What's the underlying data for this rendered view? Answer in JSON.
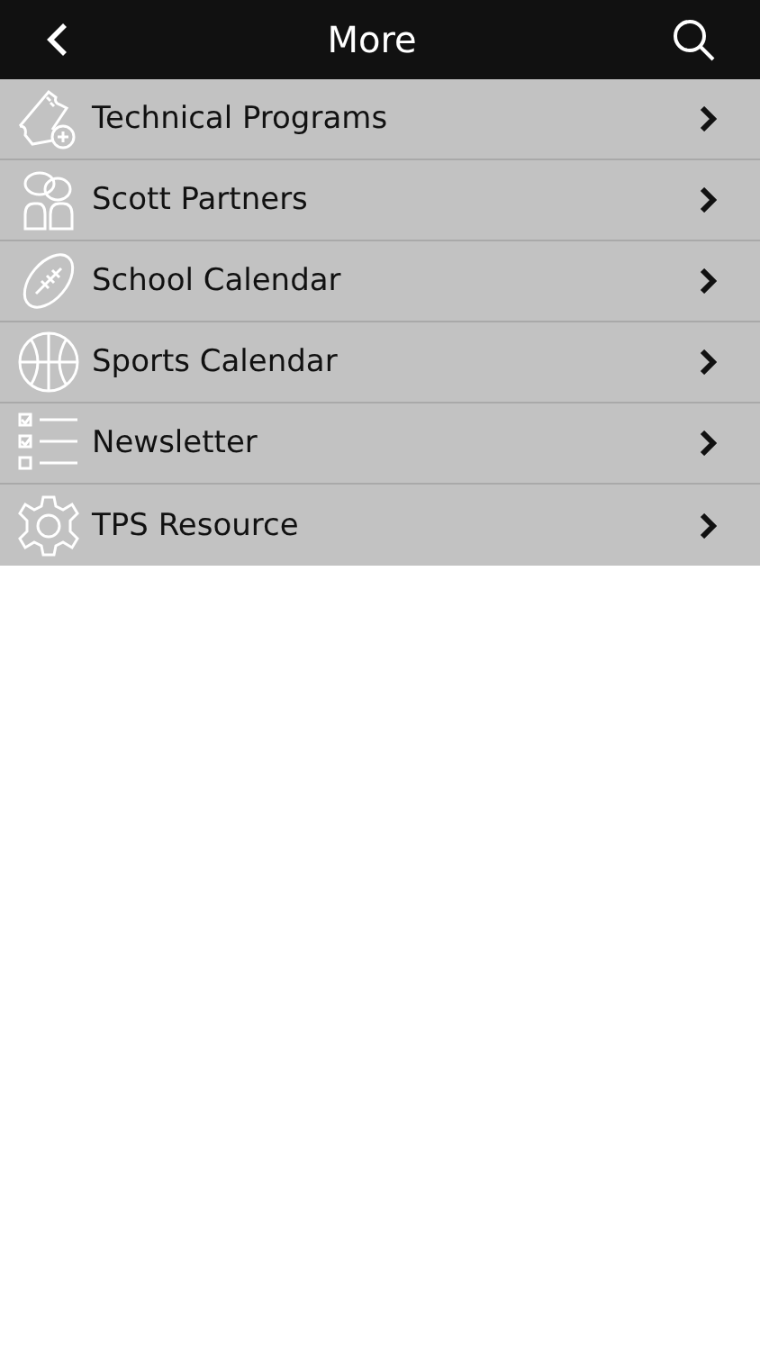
{
  "header": {
    "title": "More"
  },
  "items": [
    {
      "label": "Technical Programs",
      "kind": "ticket"
    },
    {
      "label": "Scott Partners",
      "kind": "people"
    },
    {
      "label": "School Calendar",
      "kind": "football"
    },
    {
      "label": "Sports Calendar",
      "kind": "basketball"
    },
    {
      "label": "Newsletter",
      "kind": "checklist"
    },
    {
      "label": "TPS Resource",
      "kind": "gear"
    }
  ]
}
